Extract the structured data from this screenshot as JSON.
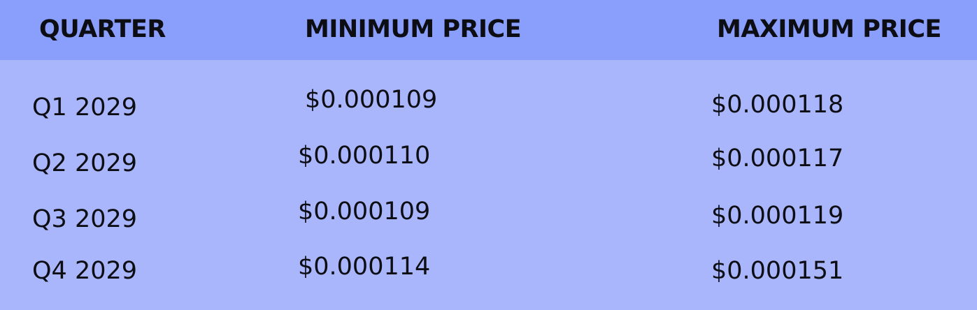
{
  "table": {
    "headers": {
      "quarter": "QUARTER",
      "min": "MINIMUM PRICE",
      "max": "MAXIMUM PRICE"
    },
    "rows": [
      {
        "quarter": "Q1 2029",
        "min": "$0.000109",
        "max": "$0.000118"
      },
      {
        "quarter": "Q2 2029",
        "min": "$0.000110",
        "max": "$0.000117"
      },
      {
        "quarter": "Q3 2029",
        "min": "$0.000109",
        "max": "$0.000119"
      },
      {
        "quarter": "Q4 2029",
        "min": "$0.000114",
        "max": "$0.000151"
      }
    ]
  },
  "colors": {
    "header_bg": "#8a9efb",
    "body_bg": "#a9b6fb",
    "text": "#0d0d14"
  }
}
